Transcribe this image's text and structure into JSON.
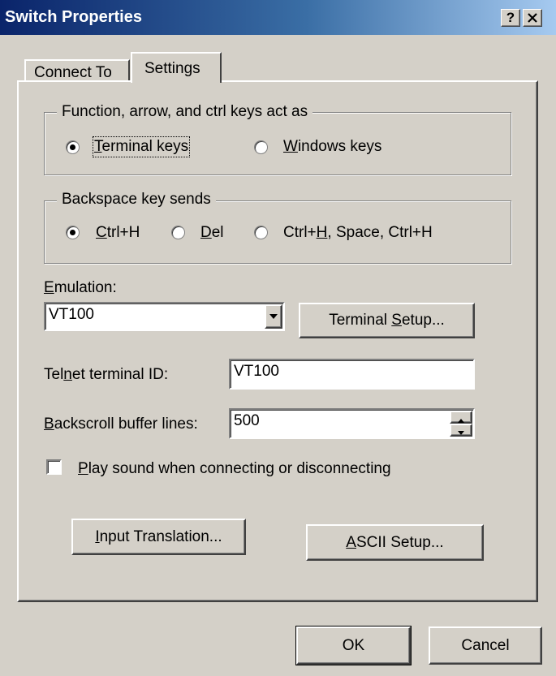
{
  "window": {
    "title": "Switch Properties",
    "help_label": "?",
    "close_label": "✕"
  },
  "tabs": [
    {
      "label": "Connect To",
      "selected": false
    },
    {
      "label": "Settings",
      "selected": true
    }
  ],
  "keys_group": {
    "legend": "Function, arrow, and ctrl keys act as",
    "options": [
      {
        "mnemonic": "T",
        "rest": "erminal keys",
        "selected": true
      },
      {
        "mnemonic": "W",
        "rest": "indows keys",
        "selected": false
      }
    ]
  },
  "backspace_group": {
    "legend": "Backspace key sends",
    "options": [
      {
        "mnemonic": "C",
        "rest": "trl+H",
        "selected": true
      },
      {
        "mnemonic": "D",
        "rest": "el",
        "selected": false
      },
      {
        "pre": "Ctrl+",
        "mnemonic": "H",
        "rest": ", Space, Ctrl+H",
        "selected": false
      }
    ]
  },
  "emulation": {
    "label_mnemonic": "E",
    "label_rest": "mulation:",
    "value": "VT100"
  },
  "terminal_setup": {
    "pre": "Terminal ",
    "mnemonic": "S",
    "rest": "etup..."
  },
  "telnet": {
    "pre": "Tel",
    "mnemonic": "n",
    "rest": "et terminal ID:",
    "value": "VT100"
  },
  "backscroll": {
    "mnemonic": "B",
    "rest": "ackscroll buffer lines:",
    "value": "500"
  },
  "play_sound": {
    "mnemonic": "P",
    "rest": "lay sound when connecting or disconnecting",
    "checked": false
  },
  "input_translation": {
    "mnemonic": "I",
    "rest": "nput Translation..."
  },
  "ascii_setup": {
    "mnemonic": "A",
    "rest": "SCII Setup..."
  },
  "footer": {
    "ok_label": "OK",
    "cancel_label": "Cancel"
  },
  "icons": {
    "dropdown": "triangle-down",
    "spinner_up": "triangle-up",
    "spinner_down": "triangle-down"
  }
}
